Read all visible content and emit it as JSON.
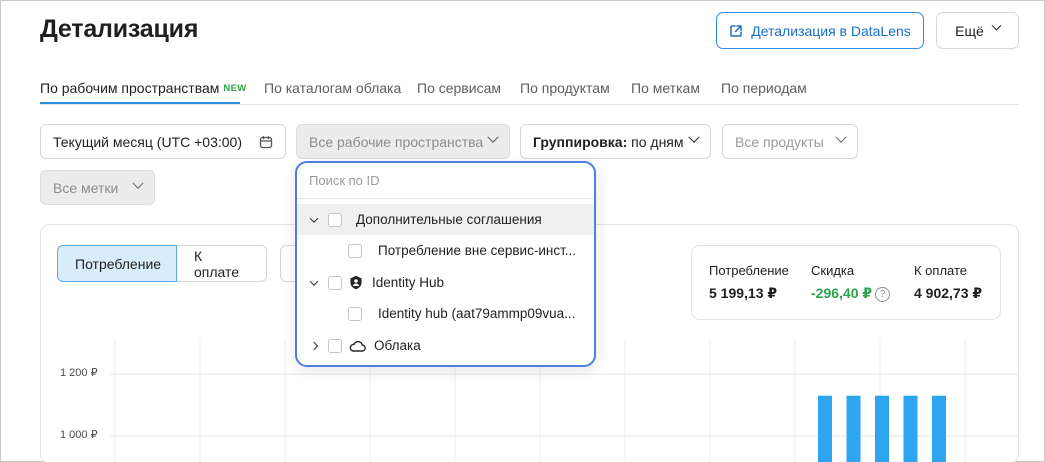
{
  "page": {
    "title": "Детализация",
    "datalens_button": "Детализация в DataLens",
    "more_button": "Ещё"
  },
  "tabs": [
    {
      "label": "По рабочим пространствам",
      "badge": "NEW"
    },
    {
      "label": "По каталогам облака"
    },
    {
      "label": "По сервисам"
    },
    {
      "label": "По продуктам"
    },
    {
      "label": "По меткам"
    },
    {
      "label": "По периодам"
    }
  ],
  "filters": {
    "period": "Текущий месяц (UTC +03:00)",
    "workspaces_placeholder": "Все рабочие пространства",
    "grouping_label": "Группировка:",
    "grouping_value": "по дням",
    "products_placeholder": "Все продукты",
    "labels_placeholder": "Все метки"
  },
  "view_toggle": {
    "consumption": "Потребление",
    "to_pay": "К оплате"
  },
  "summary": {
    "consumption_label": "Потребление",
    "consumption_value": "5 199,13 ₽",
    "discount_label": "Скидка",
    "discount_value": "-296,40 ₽",
    "to_pay_label": "К оплате",
    "to_pay_value": "4 902,73 ₽"
  },
  "dropdown": {
    "search_placeholder": "Поиск по ID",
    "items": [
      {
        "label": "Дополнительные соглашения",
        "level": 0,
        "expanded": true,
        "icon": "none"
      },
      {
        "label": "Потребление вне сервис-инст...",
        "level": 1
      },
      {
        "label": "Identity Hub",
        "level": 0,
        "expanded": true,
        "icon": "shield-icon"
      },
      {
        "label": "Identity hub (aat79ammp09vua...",
        "level": 1
      },
      {
        "label": "Облака",
        "level": 0,
        "expanded": false,
        "icon": "cloud-icon"
      }
    ]
  },
  "chart_data": {
    "type": "bar",
    "y_ticks": [
      "1 200 ₽",
      "1 000 ₽"
    ],
    "values": [
      1130,
      1130,
      1130,
      1130,
      1130
    ],
    "color": "#2da6ef",
    "accent": "#2f8ee0"
  }
}
